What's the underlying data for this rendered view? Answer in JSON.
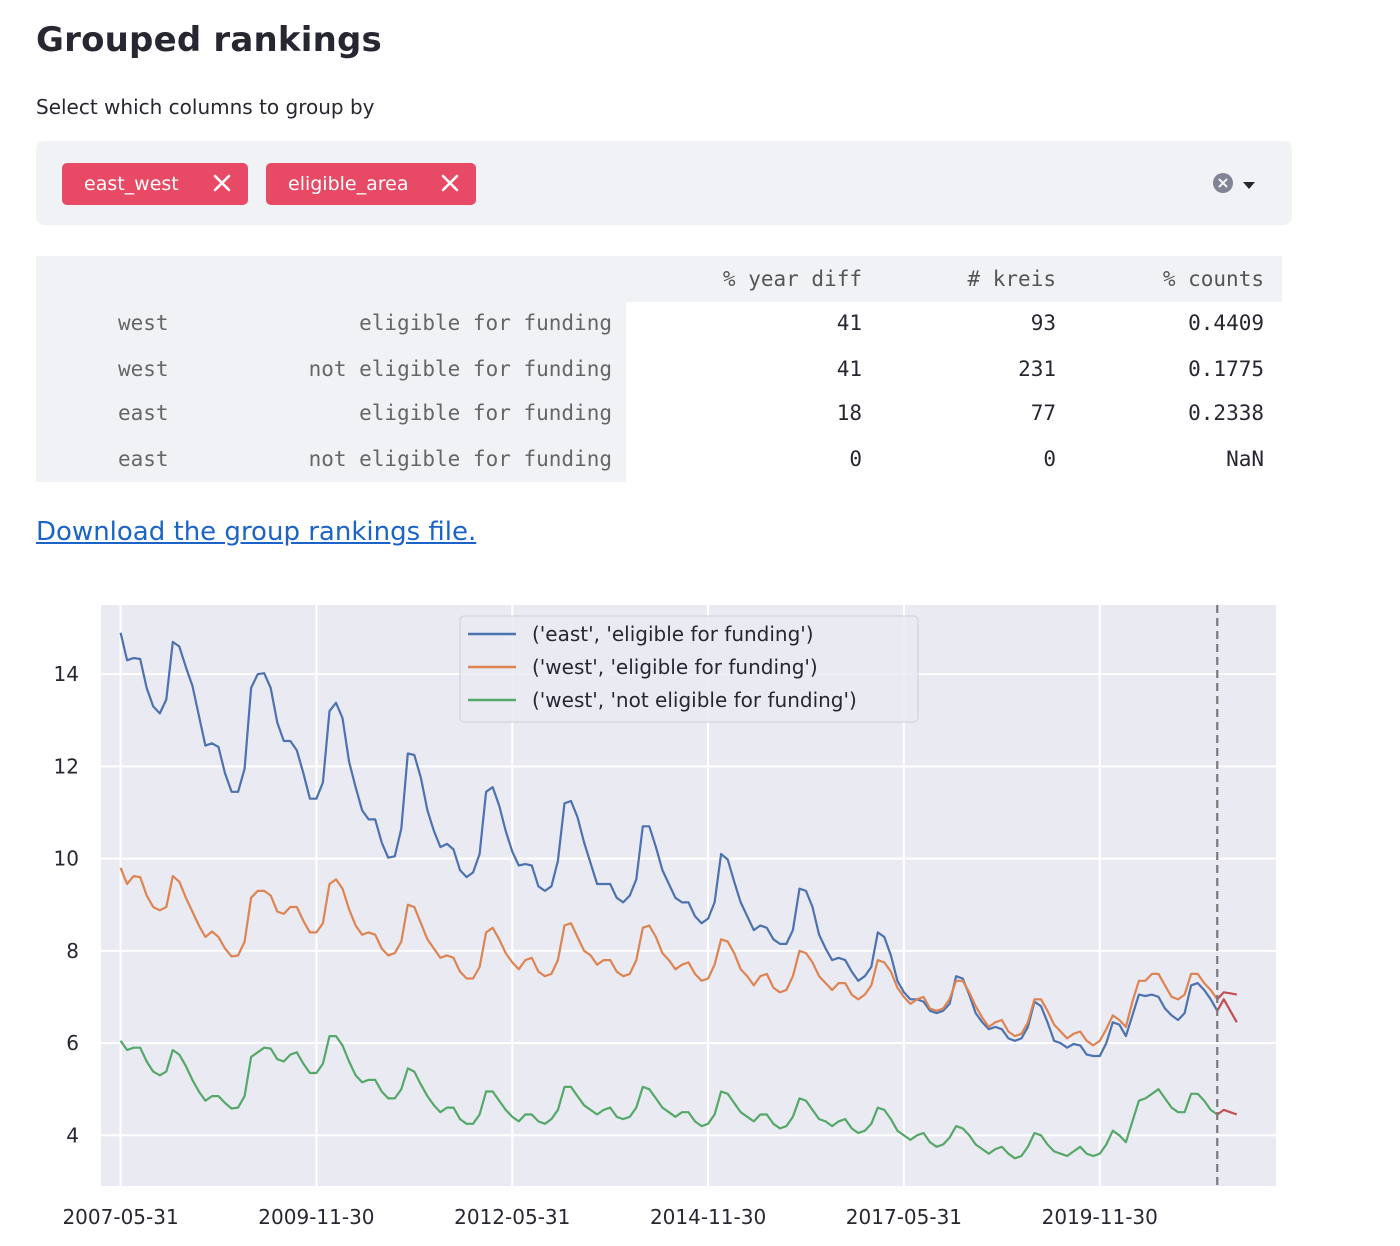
{
  "page": {
    "title": "Grouped rankings",
    "select_label": "Select which columns to group by",
    "download_link": "Download the group rankings file."
  },
  "multiselect": {
    "chips": [
      {
        "label": "east_west"
      },
      {
        "label": "eligible_area"
      }
    ],
    "icons": {
      "remove": "close-icon",
      "clear": "clear-all-icon",
      "open": "chevron-down-icon"
    },
    "chip_color": "#e84a66"
  },
  "table": {
    "columns": [
      "% year diff",
      "# kreis",
      "% counts"
    ],
    "rows": [
      {
        "index": [
          "west",
          "eligible for funding"
        ],
        "values": [
          "41",
          "93",
          "0.4409"
        ]
      },
      {
        "index": [
          "west",
          "not eligible for funding"
        ],
        "values": [
          "41",
          "231",
          "0.1775"
        ]
      },
      {
        "index": [
          "east",
          "eligible for funding"
        ],
        "values": [
          "18",
          "77",
          "0.2338"
        ]
      },
      {
        "index": [
          "east",
          "not eligible for funding"
        ],
        "values": [
          "0",
          "0",
          "NaN"
        ]
      }
    ]
  },
  "chart_data": {
    "type": "line",
    "x_tick_labels": [
      "2007-05-31",
      "2009-11-30",
      "2012-05-31",
      "2014-11-30",
      "2017-05-31",
      "2019-11-30"
    ],
    "x_tick_dates": [
      "2007-05-31",
      "2009-11-30",
      "2012-05-31",
      "2014-11-30",
      "2017-05-31",
      "2019-11-30"
    ],
    "y_ticks": [
      4,
      6,
      8,
      10,
      12,
      14
    ],
    "xlim": [
      "2007-02-28",
      "2022-02-28"
    ],
    "ylim": [
      2.9,
      15.5
    ],
    "forecast_divider_date": "2021-05-31",
    "grid": true,
    "legend_position": "top-center",
    "series": [
      {
        "name": "('east', 'eligible for funding')",
        "color": "#4c72b0",
        "start": "2007-05-31",
        "values": [
          14.9,
          14.3,
          14.35,
          14.33,
          13.7,
          13.3,
          13.15,
          13.45,
          14.7,
          14.6,
          14.15,
          13.75,
          13.1,
          12.45,
          12.5,
          12.42,
          11.85,
          11.45,
          11.45,
          11.95,
          13.7,
          14,
          14.02,
          13.7,
          12.95,
          12.55,
          12.55,
          12.35,
          11.85,
          11.3,
          11.3,
          11.65,
          13.2,
          13.38,
          13.05,
          12.1,
          11.55,
          11.05,
          10.85,
          10.85,
          10.35,
          10.02,
          10.05,
          10.65,
          12.28,
          12.25,
          11.75,
          11.05,
          10.6,
          10.25,
          10.32,
          10.2,
          9.75,
          9.6,
          9.7,
          10.1,
          11.45,
          11.55,
          11.15,
          10.6,
          10.15,
          9.85,
          9.88,
          9.85,
          9.4,
          9.3,
          9.4,
          9.95,
          11.2,
          11.25,
          10.9,
          10.35,
          9.9,
          9.45,
          9.45,
          9.45,
          9.15,
          9.05,
          9.2,
          9.55,
          10.7,
          10.7,
          10.25,
          9.75,
          9.45,
          9.15,
          9.05,
          9.05,
          8.75,
          8.6,
          8.7,
          9.05,
          10.1,
          9.98,
          9.5,
          9.05,
          8.75,
          8.45,
          8.55,
          8.5,
          8.25,
          8.15,
          8.15,
          8.45,
          9.35,
          9.3,
          8.95,
          8.35,
          8.05,
          7.8,
          7.85,
          7.8,
          7.55,
          7.35,
          7.45,
          7.65,
          8.4,
          8.3,
          7.9,
          7.35,
          7.1,
          6.95,
          6.95,
          6.9,
          6.7,
          6.65,
          6.7,
          6.85,
          7.45,
          7.4,
          7.05,
          6.65,
          6.45,
          6.3,
          6.35,
          6.3,
          6.1,
          6.05,
          6.1,
          6.35,
          6.9,
          6.8,
          6.45,
          6.05,
          6.0,
          5.9,
          5.98,
          5.95,
          5.75,
          5.72,
          5.72,
          6.0,
          6.45,
          6.4,
          6.15,
          6.6,
          7.05,
          7.02,
          7.05,
          7.0,
          6.75,
          6.6,
          6.5,
          6.65,
          7.25,
          7.3,
          7.15,
          6.95,
          6.7
        ],
        "forecast": [
          6.7,
          6.95,
          6.7,
          6.45
        ]
      },
      {
        "name": "('west', 'eligible for funding')",
        "color": "#dd8452",
        "start": "2007-05-31",
        "values": [
          9.8,
          9.45,
          9.62,
          9.6,
          9.2,
          8.95,
          8.88,
          8.95,
          9.62,
          9.5,
          9.15,
          8.85,
          8.55,
          8.3,
          8.42,
          8.3,
          8.05,
          7.88,
          7.9,
          8.2,
          9.15,
          9.3,
          9.3,
          9.2,
          8.85,
          8.8,
          8.95,
          8.95,
          8.65,
          8.4,
          8.4,
          8.6,
          9.45,
          9.55,
          9.35,
          8.9,
          8.55,
          8.35,
          8.4,
          8.35,
          8.05,
          7.9,
          7.95,
          8.2,
          9.0,
          8.95,
          8.6,
          8.25,
          8.05,
          7.85,
          7.9,
          7.85,
          7.55,
          7.4,
          7.4,
          7.65,
          8.4,
          8.5,
          8.25,
          7.95,
          7.75,
          7.6,
          7.8,
          7.85,
          7.55,
          7.45,
          7.5,
          7.8,
          8.55,
          8.6,
          8.3,
          8.0,
          7.9,
          7.7,
          7.8,
          7.8,
          7.55,
          7.45,
          7.5,
          7.8,
          8.5,
          8.55,
          8.3,
          7.95,
          7.8,
          7.6,
          7.7,
          7.75,
          7.5,
          7.35,
          7.4,
          7.7,
          8.25,
          8.2,
          7.95,
          7.6,
          7.45,
          7.25,
          7.45,
          7.5,
          7.2,
          7.1,
          7.15,
          7.45,
          8.0,
          7.95,
          7.75,
          7.45,
          7.3,
          7.15,
          7.3,
          7.3,
          7.05,
          6.95,
          7.05,
          7.25,
          7.8,
          7.75,
          7.55,
          7.2,
          7.0,
          6.85,
          6.95,
          7.0,
          6.75,
          6.7,
          6.75,
          6.95,
          7.35,
          7.35,
          7.1,
          6.8,
          6.55,
          6.35,
          6.45,
          6.5,
          6.25,
          6.15,
          6.2,
          6.45,
          6.95,
          6.95,
          6.7,
          6.4,
          6.25,
          6.1,
          6.2,
          6.25,
          6.05,
          5.95,
          6.05,
          6.3,
          6.6,
          6.5,
          6.35,
          6.9,
          7.35,
          7.35,
          7.5,
          7.5,
          7.25,
          7.0,
          6.95,
          7.05,
          7.5,
          7.5,
          7.3,
          7.15,
          6.95
        ],
        "forecast": [
          6.95,
          7.1,
          7.08,
          7.05
        ]
      },
      {
        "name": "('west', 'not eligible for funding')",
        "color": "#55a868",
        "start": "2007-05-31",
        "values": [
          6.05,
          5.85,
          5.9,
          5.9,
          5.6,
          5.38,
          5.3,
          5.38,
          5.85,
          5.75,
          5.5,
          5.2,
          4.95,
          4.75,
          4.85,
          4.85,
          4.7,
          4.58,
          4.6,
          4.85,
          5.7,
          5.8,
          5.9,
          5.88,
          5.65,
          5.6,
          5.75,
          5.8,
          5.55,
          5.35,
          5.35,
          5.55,
          6.15,
          6.15,
          5.95,
          5.6,
          5.3,
          5.15,
          5.2,
          5.2,
          4.95,
          4.8,
          4.8,
          5.0,
          5.45,
          5.38,
          5.1,
          4.85,
          4.65,
          4.5,
          4.6,
          4.6,
          4.35,
          4.25,
          4.25,
          4.45,
          4.95,
          4.95,
          4.75,
          4.55,
          4.4,
          4.3,
          4.45,
          4.45,
          4.3,
          4.25,
          4.35,
          4.55,
          5.05,
          5.05,
          4.85,
          4.65,
          4.55,
          4.45,
          4.55,
          4.6,
          4.4,
          4.35,
          4.4,
          4.6,
          5.05,
          5.0,
          4.8,
          4.6,
          4.5,
          4.4,
          4.5,
          4.5,
          4.3,
          4.2,
          4.25,
          4.45,
          4.95,
          4.9,
          4.7,
          4.5,
          4.4,
          4.3,
          4.45,
          4.45,
          4.25,
          4.15,
          4.2,
          4.4,
          4.8,
          4.75,
          4.55,
          4.35,
          4.3,
          4.2,
          4.3,
          4.35,
          4.15,
          4.05,
          4.1,
          4.25,
          4.6,
          4.55,
          4.35,
          4.1,
          4.0,
          3.9,
          4.0,
          4.05,
          3.85,
          3.75,
          3.8,
          3.95,
          4.2,
          4.15,
          4.0,
          3.8,
          3.7,
          3.6,
          3.7,
          3.75,
          3.6,
          3.5,
          3.55,
          3.75,
          4.05,
          4.0,
          3.8,
          3.65,
          3.6,
          3.55,
          3.65,
          3.75,
          3.6,
          3.55,
          3.6,
          3.8,
          4.1,
          4.0,
          3.85,
          4.3,
          4.75,
          4.8,
          4.9,
          5.0,
          4.8,
          4.6,
          4.5,
          4.5,
          4.9,
          4.9,
          4.75,
          4.55,
          4.45
        ],
        "forecast": [
          4.45,
          4.55,
          4.5,
          4.45
        ]
      }
    ],
    "forecast_color": "#c44e52",
    "divider_color": "#7a7a7a"
  }
}
